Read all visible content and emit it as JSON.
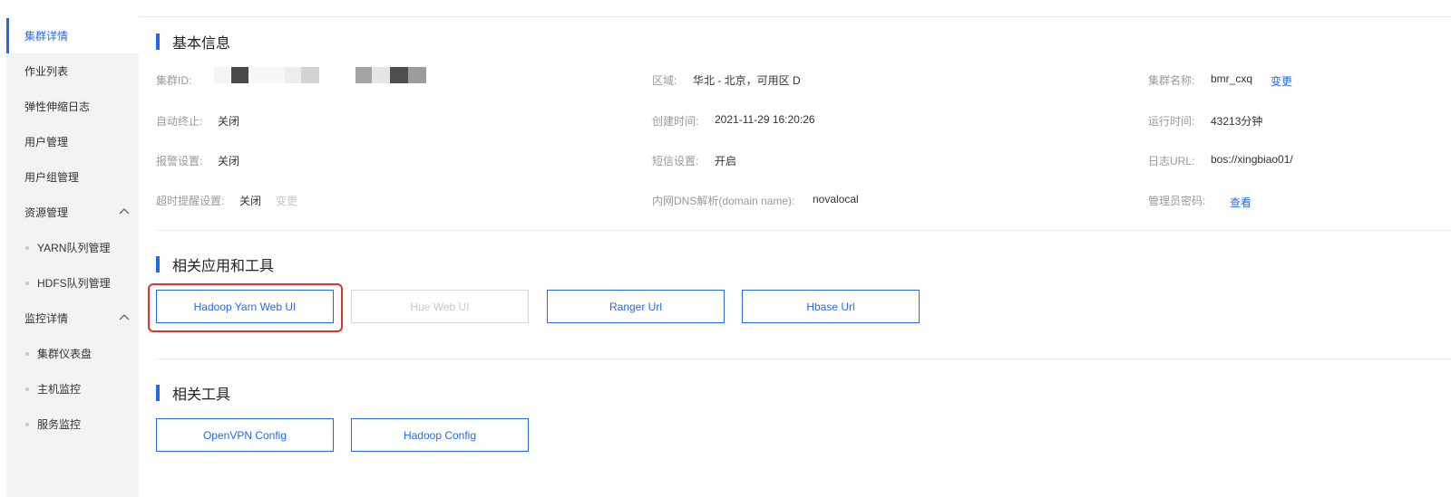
{
  "sidebar": {
    "items": [
      {
        "label": "集群详情",
        "active": true
      },
      {
        "label": "作业列表"
      },
      {
        "label": "弹性伸缩日志"
      },
      {
        "label": "用户管理"
      },
      {
        "label": "用户组管理"
      },
      {
        "label": "资源管理",
        "expandable": true
      },
      {
        "label": "YARN队列管理",
        "sub": true
      },
      {
        "label": "HDFS队列管理",
        "sub": true
      },
      {
        "label": "监控详情",
        "expandable": true
      },
      {
        "label": "集群仪表盘",
        "sub": true
      },
      {
        "label": "主机监控",
        "sub": true
      },
      {
        "label": "服务监控",
        "sub": true
      }
    ]
  },
  "basic_info": {
    "title": "基本信息",
    "cluster_id_label": "集群ID:",
    "region_label": "区域:",
    "region_value": "华北 - 北京，可用区 D",
    "cluster_name_label": "集群名称:",
    "cluster_name_value": "bmr_cxq",
    "change_link": "变更",
    "auto_stop_label": "自动终止:",
    "auto_stop_value": "关闭",
    "create_time_label": "创建时间:",
    "create_time_value": "2021-11-29 16:20:26",
    "run_time_label": "运行时间:",
    "run_time_value": "43213分钟",
    "alarm_label": "报警设置:",
    "alarm_value": "关闭",
    "sms_label": "短信设置:",
    "sms_value": "开启",
    "log_url_label": "日志URL:",
    "log_url_value": "bos://xingbiao01/",
    "timeout_label": "超时提醒设置:",
    "timeout_value": "关闭",
    "timeout_change_link": "变更",
    "dns_label": "内网DNS解析(domain name):",
    "dns_value": "novalocal",
    "admin_pwd_label": "管理员密码:",
    "view_link": "查看"
  },
  "apps": {
    "title": "相关应用和工具",
    "buttons": [
      {
        "label": "Hadoop Yarn Web UI"
      },
      {
        "label": "Hue Web UI",
        "disabled": true
      },
      {
        "label": "Ranger Url"
      },
      {
        "label": "Hbase Url"
      }
    ]
  },
  "tools": {
    "title": "相关工具",
    "buttons": [
      {
        "label": "OpenVPN Config"
      },
      {
        "label": "Hadoop Config"
      }
    ]
  },
  "colors": {
    "accent": "#2468f2",
    "highlight": "#e0322a"
  }
}
